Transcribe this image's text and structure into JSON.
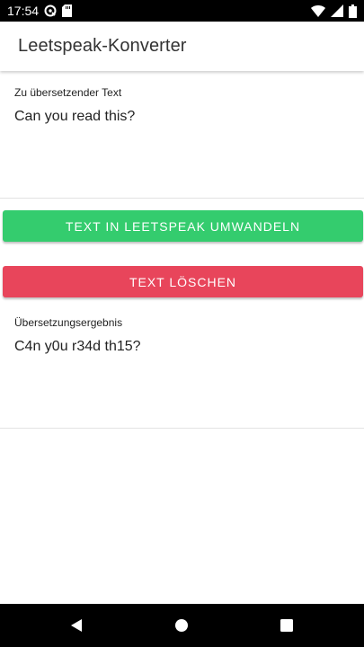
{
  "status_bar": {
    "time": "17:54",
    "icons": [
      "sync-icon",
      "sd-card-icon",
      "wifi-icon",
      "signal-icon",
      "battery-icon"
    ]
  },
  "toolbar": {
    "title": "Leetspeak-Konverter"
  },
  "input": {
    "label": "Zu übersetzender Text",
    "value": "Can you read this?"
  },
  "buttons": {
    "convert_label": "TEXT IN LEETSPEAK UMWANDELN",
    "clear_label": "TEXT LÖSCHEN"
  },
  "result": {
    "label": "Übersetzungsergebnis",
    "value": "C4n y0u r34d th15?"
  },
  "navigation": {
    "icons": [
      "back-icon",
      "home-icon",
      "recents-icon"
    ]
  },
  "colors": {
    "convert_button": "#34cc6e",
    "clear_button": "#e8455b"
  }
}
